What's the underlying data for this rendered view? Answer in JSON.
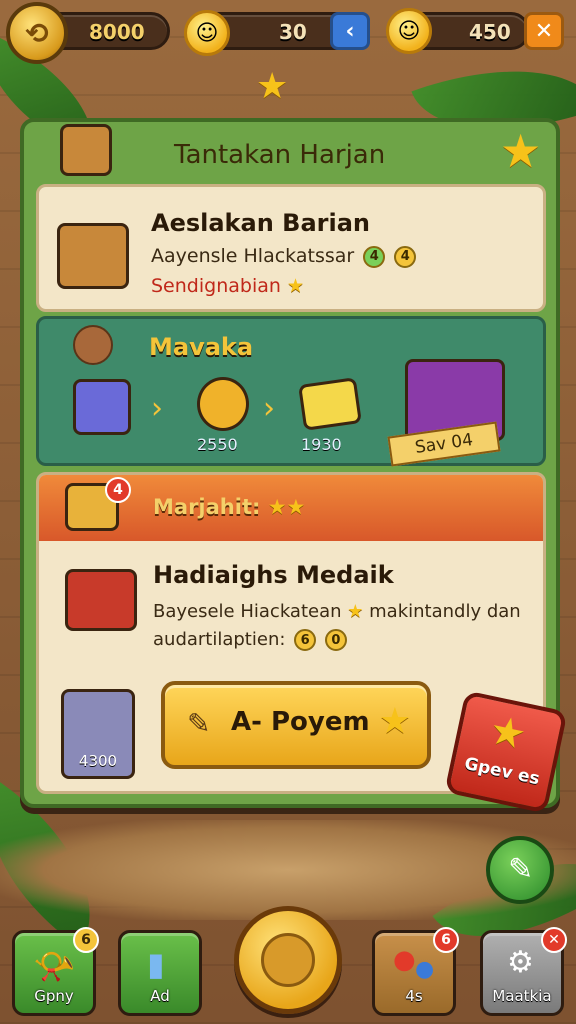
{
  "topbar": {
    "coins": "8000",
    "lives": "30",
    "suns": "450",
    "back_icon": "chevron-left-icon",
    "close_icon": "close-icon"
  },
  "frame": {
    "title": "Tantakan Harjan"
  },
  "card1": {
    "title": "Aeslakan Barian",
    "line1": "Aayensle Hlackatssar",
    "line1_badges": [
      "4",
      "4"
    ],
    "line2": "Sendignabian"
  },
  "card2": {
    "title": "Mavaka",
    "item1_value": "2550",
    "item2_value": "1930",
    "ribbon": "Sav 04"
  },
  "card3": {
    "header": "Marjahit:",
    "header_badge": "4",
    "title": "Hadiaighs Medaik",
    "line1": "Bayesele Hiackatean",
    "line1_tail": "makintandly dan",
    "line2": "audartilaptien:",
    "line2_badges": [
      "6",
      "0"
    ],
    "chest_value": "4300",
    "play_button": "A- Poyem",
    "side_button": "Gpev es"
  },
  "bottom_nav": [
    {
      "label": "Gpny",
      "badge": "6",
      "color": "#5aa83a"
    },
    {
      "label": "Ad",
      "badge": "",
      "color": "#5aa83a"
    },
    {
      "label": "4s",
      "badge": "6",
      "color": "#b07a3a"
    },
    {
      "label": "Maatkia",
      "badge": "",
      "color": "#8a8a8a"
    }
  ],
  "colors": {
    "frame_green": "#6ea447",
    "card_teal": "#3f8a6a",
    "header_orange": "#e06a2a",
    "play_yellow": "#f4c43a"
  }
}
